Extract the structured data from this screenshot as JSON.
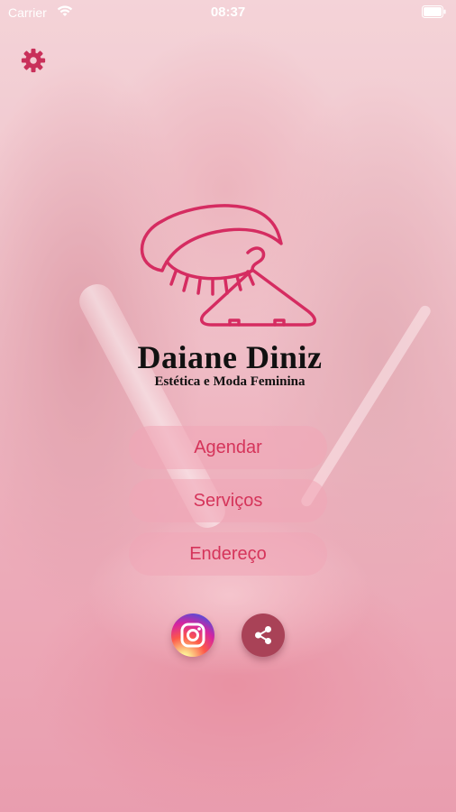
{
  "status_bar": {
    "carrier": "Carrier",
    "time": "08:37"
  },
  "icons": {
    "wifi": "wifi-icon",
    "battery": "battery-icon",
    "settings": "gear-icon",
    "logo": "eye-lash-hanger-logo",
    "instagram": "instagram-icon",
    "share": "share-icon"
  },
  "brand": {
    "name": "Daiane Diniz",
    "tagline": "Estética e Moda Feminina"
  },
  "menu": {
    "agendar": "Agendar",
    "servicos": "Serviços",
    "endereco": "Endereço"
  },
  "colors": {
    "accent": "#D5345A",
    "button_bg": "#F1A5B6",
    "share_bg": "#A94257",
    "background": "#F1C6CD"
  }
}
